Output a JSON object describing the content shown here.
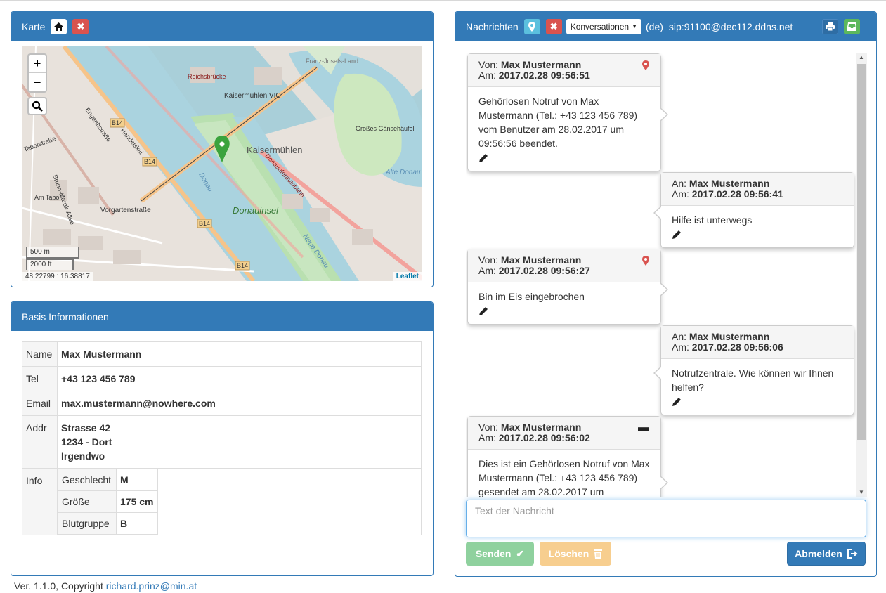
{
  "map_panel": {
    "title": "Karte",
    "home_icon": "home-icon",
    "close_icon": "close-icon",
    "zoom_in": "+",
    "zoom_out": "−",
    "scale_metric": "500 m",
    "scale_imperial": "2000 ft",
    "coords": "48.22799 : 16.38817",
    "attribution": "Leaflet",
    "map_labels": [
      "Reichsbrücke",
      "Kaisermühlen VIC",
      "Kaisermühlen",
      "Donauinsel",
      "Großes Gänsehäufel",
      "Vorgartenstraße",
      "Donau",
      "Neue Donau",
      "Alte Donau",
      "Franz-Josefs-Land",
      "Handelskai",
      "Engerthstraße",
      "Taborstraße",
      "Bruno-Marek-Allee",
      "Am Tabor",
      "Donauuferautobahn",
      "B14"
    ]
  },
  "info_panel": {
    "title": "Basis Informationen",
    "name_label": "Name",
    "name": "Max Mustermann",
    "tel_label": "Tel",
    "tel": "+43 123 456 789",
    "email_label": "Email",
    "email": "max.mustermann@nowhere.com",
    "addr_label": "Addr",
    "addr_line1": "Strasse 42",
    "addr_line2": "1234 - Dort",
    "addr_line3": "Irgendwo",
    "info_label": "Info",
    "sex_label": "Geschlecht",
    "sex": "M",
    "height_label": "Größe",
    "height": "175 cm",
    "blood_label": "Blutgruppe",
    "blood": "B"
  },
  "messages_panel": {
    "title": "Nachrichten",
    "select_value": "Konversationen",
    "lang": "(de)",
    "sip": "sip:91100@dec112.ddns.net",
    "print_icon": "print-icon",
    "inbox_icon": "inbox-icon",
    "messages": [
      {
        "prefix": "Von:",
        "name": "Max Mustermann",
        "date_prefix": "Am:",
        "date": "2017.02.28 09:56:51",
        "text": "Gehörlosen Notruf von Max Mustermann (Tel.: +43 123 456 789) vom Benutzer am 28.02.2017 um 09:56:56 beendet.",
        "icon": "map-marker-icon"
      },
      {
        "prefix": "An:",
        "name": "Max Mustermann",
        "date_prefix": "Am:",
        "date": "2017.02.28 09:56:41",
        "text": "Hilfe ist unterwegs"
      },
      {
        "prefix": "Von:",
        "name": "Max Mustermann",
        "date_prefix": "Am:",
        "date": "2017.02.28 09:56:27",
        "text": "Bin im Eis eingebrochen",
        "icon": "map-marker-icon"
      },
      {
        "prefix": "An:",
        "name": "Max Mustermann",
        "date_prefix": "Am:",
        "date": "2017.02.28 09:56:06",
        "text": "Notrufzentrale. Wie können wir Ihnen helfen?"
      },
      {
        "prefix": "Von:",
        "name": "Max Mustermann",
        "date_prefix": "Am:",
        "date": "2017.02.28 09:56:02",
        "text": "Dies ist ein Gehörlosen Notruf von Max Mustermann (Tel.: +43 123 456 789) gesendet am 28.02.2017 um",
        "icon": "minus-icon"
      }
    ],
    "input_placeholder": "Text der Nachricht",
    "send_label": "Senden",
    "delete_label": "Löschen",
    "logout_label": "Abmelden"
  },
  "footer": {
    "version": "Ver. 1.1.0, Copyright",
    "email": "richard.prinz@min.at"
  },
  "colors": {
    "primary": "#337ab7",
    "danger": "#d9534f",
    "info": "#5bc0de",
    "success_disabled": "#8fd19e",
    "warning_disabled": "#f7ce8f",
    "marker_green": "#3aa33d"
  }
}
